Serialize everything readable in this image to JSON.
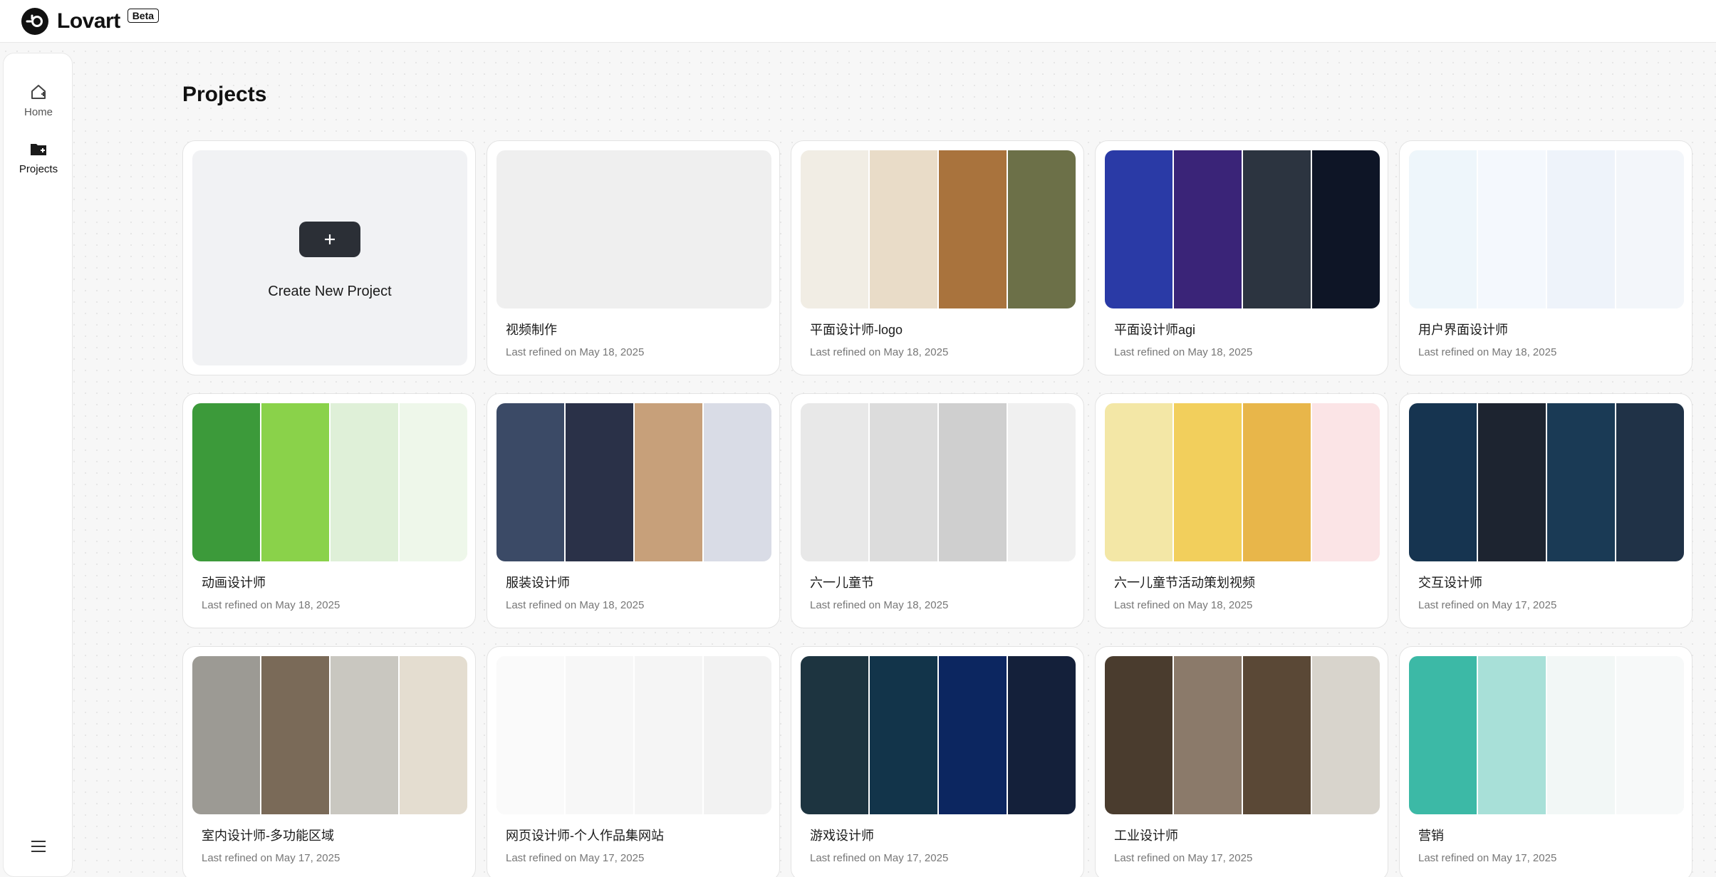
{
  "app": {
    "name": "Lovart",
    "badge": "Beta"
  },
  "sidebar": {
    "items": [
      {
        "label": "Home",
        "icon": "home-plus-icon"
      },
      {
        "label": "Projects",
        "icon": "folder-plus-icon"
      }
    ],
    "menu_icon": "menu-icon"
  },
  "main": {
    "title": "Projects",
    "new_project": {
      "label": "Create New Project",
      "icon": "plus-icon"
    },
    "projects": [
      {
        "title": "视频制作",
        "date": "Last refined on May 18, 2025",
        "thumbs": []
      },
      {
        "title": "平面设计师-logo",
        "date": "Last refined on May 18, 2025",
        "thumbs": [
          "#f1ede4",
          "#e9dcc8",
          "#a9733d",
          "#6c7048"
        ]
      },
      {
        "title": "平面设计师agi",
        "date": "Last refined on May 18, 2025",
        "thumbs": [
          "#2a3aa6",
          "#3a2478",
          "#2c3440",
          "#0e1526"
        ]
      },
      {
        "title": "用户界面设计师",
        "date": "Last refined on May 18, 2025",
        "thumbs": [
          "#eef6fb",
          "#f4f8fd",
          "#eef3fa",
          "#f3f6fa"
        ]
      },
      {
        "title": "动画设计师",
        "date": "Last refined on May 18, 2025",
        "thumbs": [
          "#3c9a3a",
          "#8ad24a",
          "#dff0d8",
          "#eef7ea"
        ]
      },
      {
        "title": "服装设计师",
        "date": "Last refined on May 18, 2025",
        "thumbs": [
          "#3b4a66",
          "#2a3148",
          "#c7a07a",
          "#d9dce6"
        ]
      },
      {
        "title": "六一儿童节",
        "date": "Last refined on May 18, 2025",
        "thumbs": [
          "#e8e8e8",
          "#dcdcdc",
          "#cfcfcf",
          "#f0f0f0"
        ]
      },
      {
        "title": "六一儿童节活动策划视频",
        "date": "Last refined on May 18, 2025",
        "thumbs": [
          "#f3e7a6",
          "#f2cf5c",
          "#e8b64a",
          "#fbe4e6"
        ]
      },
      {
        "title": "交互设计师",
        "date": "Last refined on May 17, 2025",
        "thumbs": [
          "#163450",
          "#1d2430",
          "#1a3a55",
          "#203247"
        ]
      },
      {
        "title": "室内设计师-多功能区域",
        "date": "Last refined on May 17, 2025",
        "thumbs": [
          "#9c9a94",
          "#7a6a58",
          "#c9c7c0",
          "#e4ddd0"
        ]
      },
      {
        "title": "网页设计师-个人作品集网站",
        "date": "Last refined on May 17, 2025",
        "thumbs": [
          "#fafafa",
          "#f7f7f7",
          "#f5f5f5",
          "#f2f2f2"
        ]
      },
      {
        "title": "游戏设计师",
        "date": "Last refined on May 17, 2025",
        "thumbs": [
          "#1d3440",
          "#12344a",
          "#0c2660",
          "#14203a"
        ]
      },
      {
        "title": "工业设计师",
        "date": "Last refined on May 17, 2025",
        "thumbs": [
          "#4a3c2e",
          "#8b7a6a",
          "#5a4836",
          "#d8d4cc"
        ]
      },
      {
        "title": "营销",
        "date": "Last refined on May 17, 2025",
        "thumbs": [
          "#3cb9a6",
          "#a8e0d8",
          "#f2f7f6",
          "#f7f9f9"
        ]
      }
    ]
  }
}
